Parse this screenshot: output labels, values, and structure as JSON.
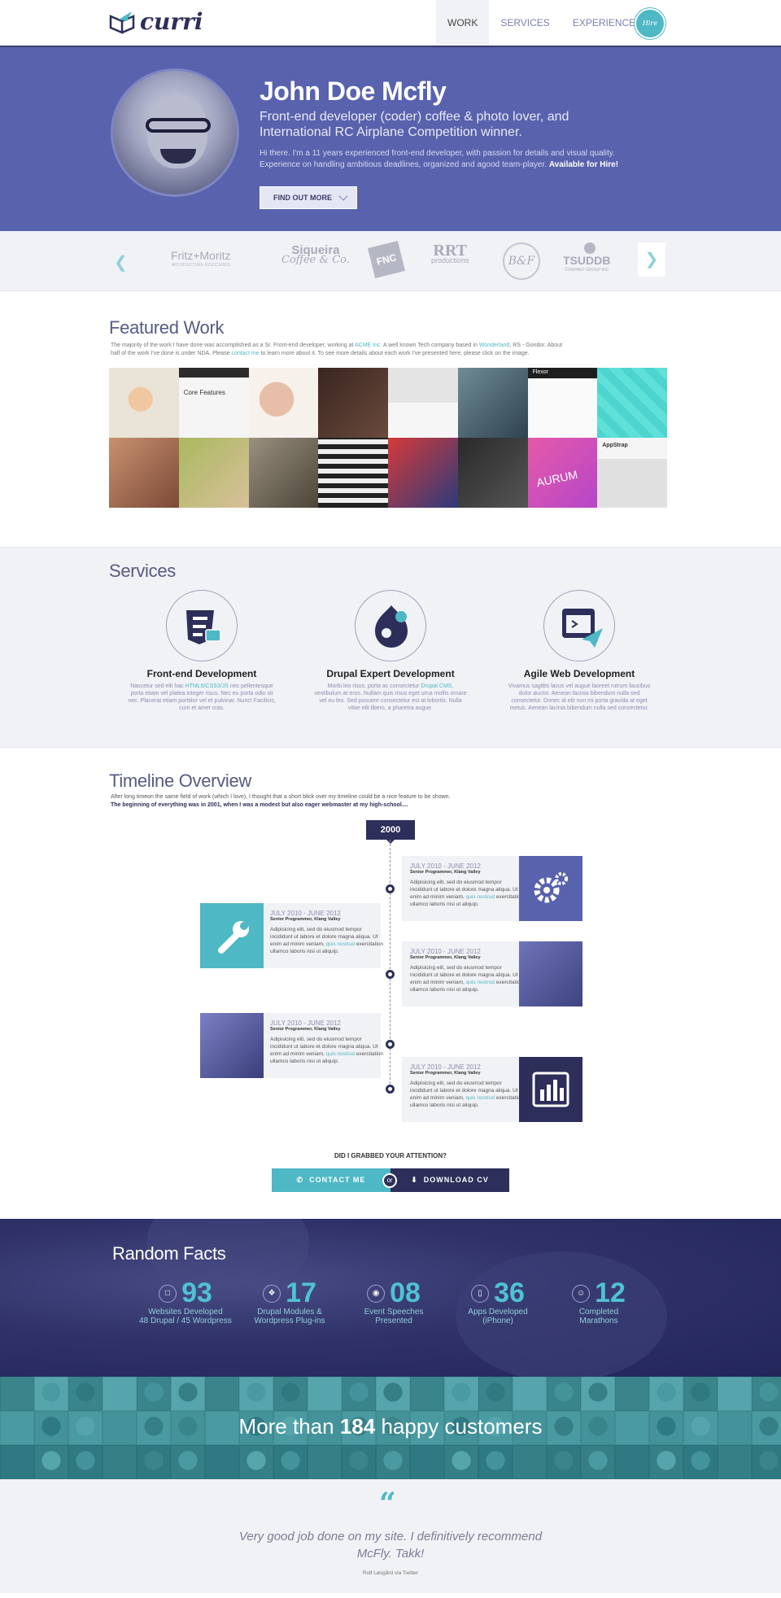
{
  "header": {
    "logo_text": "curri",
    "nav": [
      "WORK",
      "SERVICES",
      "EXPERIENCE"
    ],
    "hire_label": "Hire me!"
  },
  "hero": {
    "name": "John Doe Mcfly",
    "tagline": "Front-end developer (coder) coffee & photo lover, and International RC Airplane Competition winner.",
    "bio": "Hi there. I'm a 11 years experienced front-end developer, with passion for details and visual quality. Experience on handling ambitious deadlines, organized and agood team-player.",
    "bio_bold": "Available for Hire!",
    "button": "FIND OUT MORE"
  },
  "clients": [
    {
      "name": "Fritz+Moritz",
      "sub": "ARCHITECTURE ASSOCIATES"
    },
    {
      "name": "Siqueira",
      "sub": "Coffee & Co."
    },
    {
      "name": "FNC",
      "sub": ""
    },
    {
      "name": "RRT",
      "sub": "productions"
    },
    {
      "name": "B&F",
      "sub": ""
    },
    {
      "name": "TSUDDB",
      "sub": "COMPANY GROUP INC"
    }
  ],
  "featured": {
    "title": "Featured Work",
    "text_1": "The majority of the work I have done was accomplished as a Sr. Front-end developer, working at",
    "link_1": "ACME Inc.",
    "text_2": "A well known Tech company based in",
    "link_2": "Wonderland",
    "text_3": ", RS - Gondor. About half of the work I've done is under NDA. Please",
    "link_3": "contact me",
    "text_4": "to learn more about it. To see more details about each work I've presented here, please click on the image.",
    "tile_core": "Core Features",
    "tile_flexor": "Flexor",
    "tile_appstrap": "AppStrap",
    "tile_aurum": "AURUM"
  },
  "services": {
    "title": "Services",
    "items": [
      {
        "title": "Front-end Development",
        "text_a": "Nascetur sed elit hac",
        "link": "HTML5/CSS3/JS",
        "text_b": "nec pellentesque porta etiam vel platea integer risus. Nec eu porta odio sit nec. Placerat etiam porttitor vel et pulvinar. Nunc! Facilisis, cum et amet cras."
      },
      {
        "title": "Drupal Expert Development",
        "text_a": "Morbi leo risus, porta ac consectetur",
        "link": "Drupal CMS",
        "text_b": ", vestibulum at eros. Nullam quis risus eget urna mollis ornare vel eu leo. Sed posuere consectetur est at lobortis. Nulla vitae elit libero, a pharetra augue."
      },
      {
        "title": "Agile Web Development",
        "text_a": "Vivamus sagittis lacus vel augue laoreet rutrum faucibus dolor auctor. Aenean lacinia bibendum nulla sed consectetur. Donec id elit non mi porta gravida at eget metus. Aenean lacinia bibendum nulla sed consectetur.",
        "link": "",
        "text_b": ""
      }
    ]
  },
  "timeline": {
    "title": "Timeline Overview",
    "sub": "After long timeon the same field of work (which I love), I thought that a short blick over my timeline could be a nice feature to be shown.",
    "sub_bold": "The beginning of everything was in 2001, when I was a modest but also eager webmaster at my high-school....",
    "year": "2000",
    "entry": {
      "date": "JULY 2010 - JUNE 2012",
      "role": "Senior Programmer, Klang Valley",
      "body": "Adipisicing elit, sed do eiusmod tempor incididunt ut labore et dolore magna aliqua. Ut enim ad minim veniam,",
      "link": "quis nostrud",
      "body_end": "exercitation ullamco laboris nisi ut aliquip."
    },
    "cta_question": "DID I GRABBED YOUR ATTENTION?",
    "contact": "CONTACT ME",
    "or": "or",
    "download": "DOWNLOAD CV"
  },
  "facts": {
    "title": "Random Facts",
    "items": [
      {
        "num": "93",
        "line1": "Websites Developed",
        "line2": "48 Drupal / 45 Wordpress",
        "icon": "laptop-icon"
      },
      {
        "num": "17",
        "line1": "Drupal Modules &",
        "line2": "Wordpress Plug-ins",
        "icon": "puzzle-icon"
      },
      {
        "num": "08",
        "line1": "Event Speeches",
        "line2": "Presented",
        "icon": "chat-icon"
      },
      {
        "num": "36",
        "line1": "Apps Developed",
        "line2": "(iPhone)",
        "icon": "phone-icon"
      },
      {
        "num": "12",
        "line1": "Completed",
        "line2": "Marathons",
        "icon": "smile-icon"
      }
    ]
  },
  "customers": {
    "pre": "More than",
    "count": "184",
    "post": "happy customers"
  },
  "testimonial": {
    "text": "Very good job done on my site. I definitively recommend McFly. Takk!",
    "author": "Rolf Løsgård via Twitter"
  }
}
